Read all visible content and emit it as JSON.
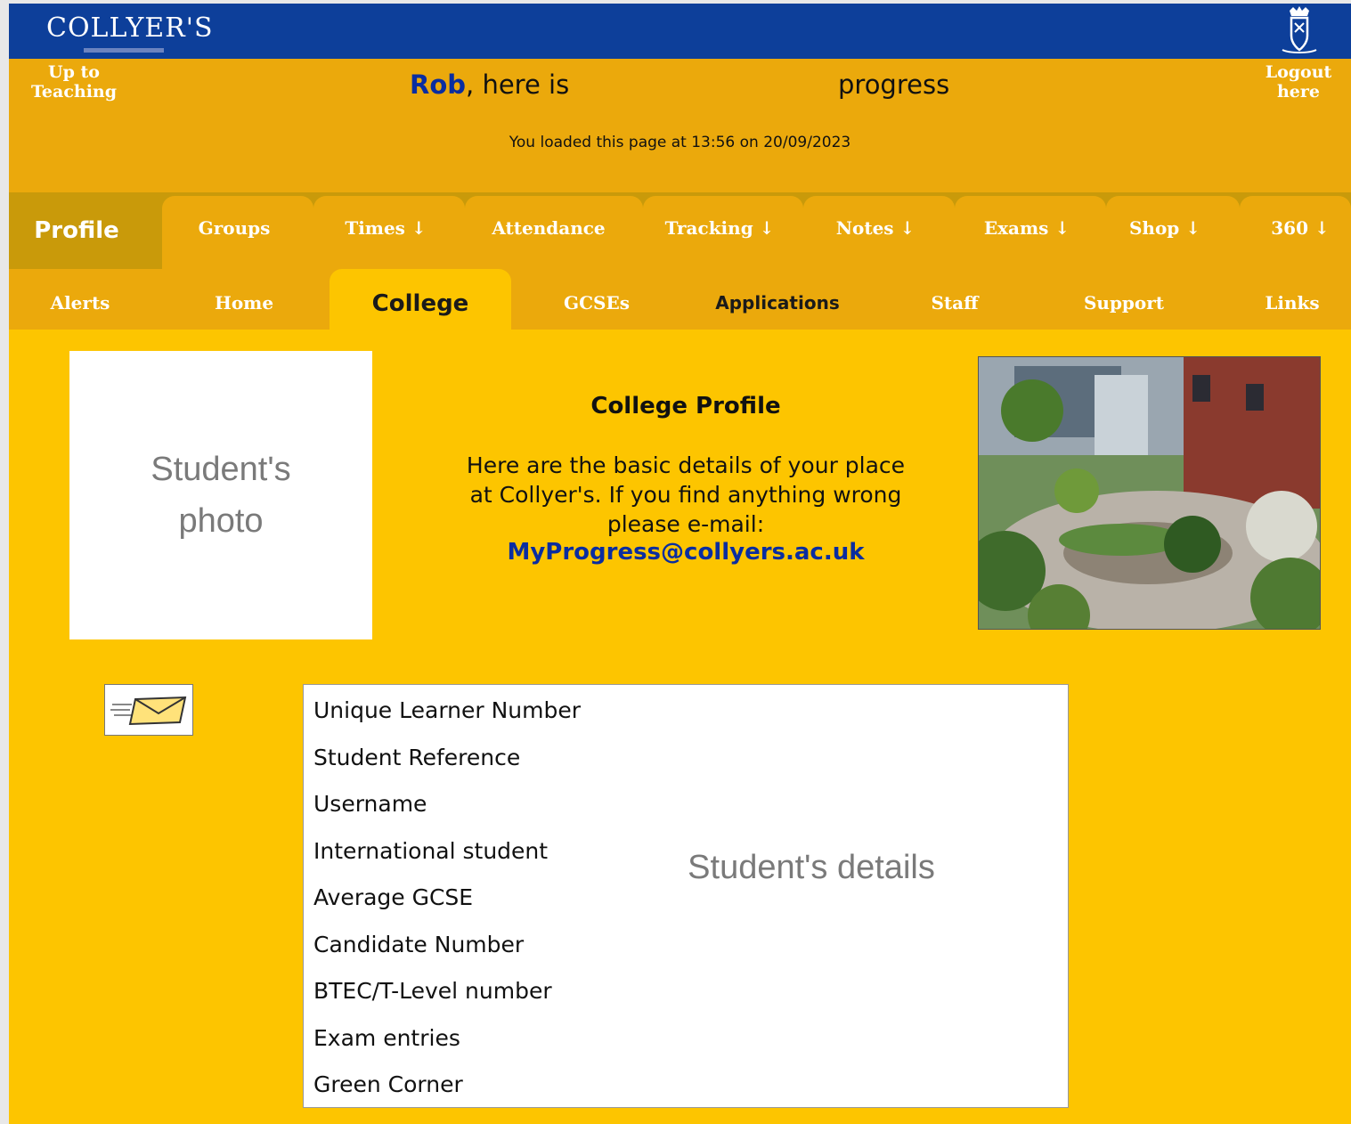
{
  "header": {
    "logo_text": "COLLYER'S",
    "up_link": "Up to Teaching",
    "logout_link": "Logout here",
    "student_name": "Rob",
    "headline_middle": ", here is",
    "headline_end": "progress",
    "loaded_text": "You loaded this page at 13:56 on 20/09/2023"
  },
  "tabs_row1": [
    {
      "label": "Profile"
    },
    {
      "label": "Groups"
    },
    {
      "label": "Times ↓"
    },
    {
      "label": "Attendance"
    },
    {
      "label": "Tracking ↓"
    },
    {
      "label": "Notes ↓"
    },
    {
      "label": "Exams ↓"
    },
    {
      "label": "Shop ↓"
    },
    {
      "label": "360 ↓"
    }
  ],
  "tabs_row2": [
    {
      "label": "Alerts"
    },
    {
      "label": "Home"
    },
    {
      "label": "College"
    },
    {
      "label": "GCSEs"
    },
    {
      "label": "Applications"
    },
    {
      "label": "Staff"
    },
    {
      "label": "Support"
    },
    {
      "label": "Links"
    }
  ],
  "profile": {
    "photo_placeholder": "Student's photo",
    "title": "College Profile",
    "description": "Here are the basic details of your place at Collyer's. If you find anything wrong please e-mail:",
    "email": "MyProgress@collyers.ac.uk"
  },
  "details": {
    "rows": [
      "Unique Learner Number",
      "Student Reference",
      "Username",
      "International student",
      "Average GCSE",
      "Candidate Number",
      "BTEC/T-Level number",
      "Exam entries",
      "Green Corner"
    ],
    "placeholder": "Student's details"
  },
  "icons": {
    "crest": "crest-icon",
    "mail": "envelope-icon"
  },
  "colors": {
    "brand_blue": "#0D3F9A",
    "header_orange": "#EBA90C",
    "page_yellow": "#FDC500",
    "link_blue": "#0A2DA0"
  }
}
